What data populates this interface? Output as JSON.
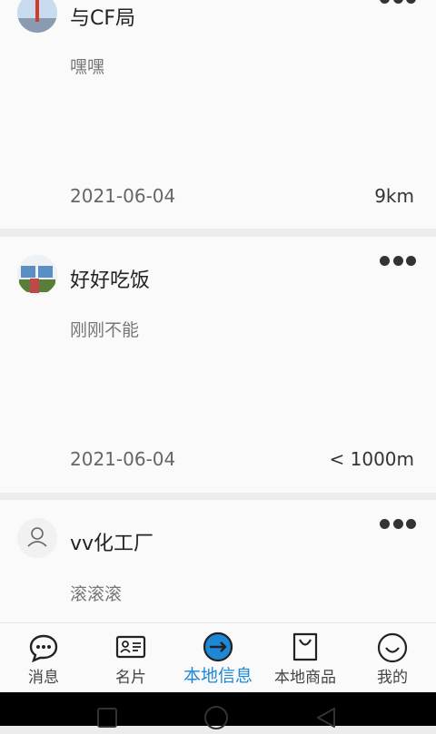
{
  "posts": [
    {
      "name": "与CF局",
      "text": "嘿嘿",
      "date": "2021-06-04",
      "distance": "9km"
    },
    {
      "name": "好好吃饭",
      "text": "刚刚不能",
      "date": "2021-06-04",
      "distance": "< 1000m"
    },
    {
      "name": "vv化工厂",
      "text": "滚滚滚"
    }
  ],
  "tabs": [
    {
      "label": "消息",
      "icon": "message-icon"
    },
    {
      "label": "名片",
      "icon": "business-card-icon"
    },
    {
      "label": "本地信息",
      "icon": "local-info-icon"
    },
    {
      "label": "本地商品",
      "icon": "shopping-bag-icon"
    },
    {
      "label": "我的",
      "icon": "smiley-icon"
    }
  ],
  "active_tab": "本地信息",
  "colors": {
    "accent": "#1e88d6",
    "text": "#222222",
    "muted": "#777777"
  }
}
